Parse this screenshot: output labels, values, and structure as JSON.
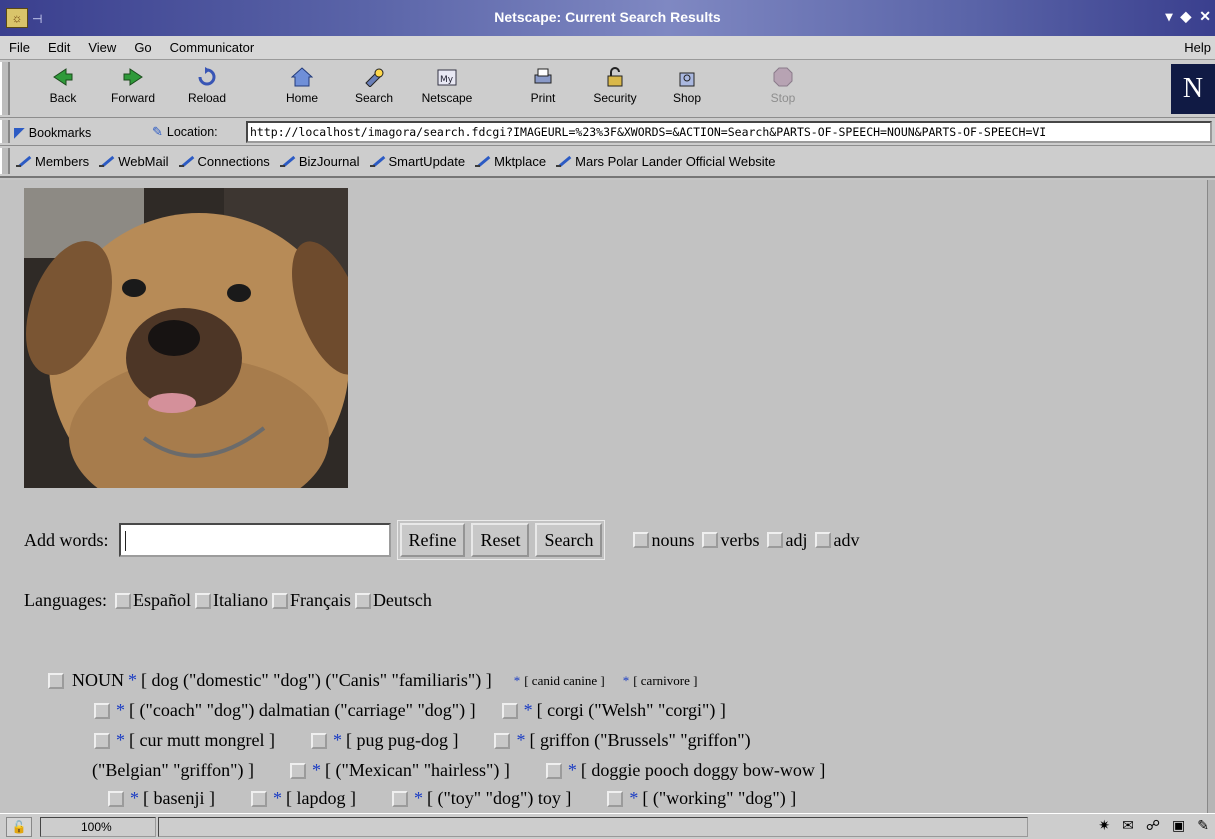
{
  "window": {
    "title": "Netscape: Current Search Results"
  },
  "menu": {
    "items": [
      "File",
      "Edit",
      "View",
      "Go",
      "Communicator"
    ],
    "help": "Help"
  },
  "toolbar": {
    "back": "Back",
    "forward": "Forward",
    "reload": "Reload",
    "home": "Home",
    "search": "Search",
    "netscape": "Netscape",
    "print": "Print",
    "security": "Security",
    "shop": "Shop",
    "stop": "Stop"
  },
  "location": {
    "bookmarks_label": "Bookmarks",
    "location_label": "Location:",
    "url": "http://localhost/imagora/search.fdcgi?IMAGEURL=%23%3F&XWORDS=&ACTION=Search&PARTS-OF-SPEECH=NOUN&PARTS-OF-SPEECH=VI"
  },
  "personal": {
    "links": [
      "Members",
      "WebMail",
      "Connections",
      "BizJournal",
      "SmartUpdate",
      "Mktplace",
      "Mars Polar Lander Official Website"
    ]
  },
  "search_form": {
    "add_words_label": "Add words:",
    "input_value": "",
    "refine": "Refine",
    "reset": "Reset",
    "search": "Search",
    "pos": [
      "nouns",
      "verbs",
      "adj",
      "adv"
    ],
    "languages_label": "Languages:",
    "languages": [
      "Español",
      "Italiano",
      "Français",
      "Deutsch"
    ]
  },
  "results": {
    "noun_label": "NOUN",
    "main": "[ dog (\"domestic\" \"dog\") (\"Canis\" \"familiaris\") ]",
    "hyper1": "[ canid canine ]",
    "hyper2": "[ carnivore ]",
    "r2a": "[ (\"coach\" \"dog\") dalmatian (\"carriage\" \"dog\") ]",
    "r2b": "[ corgi (\"Welsh\" \"corgi\") ]",
    "r3a": "[ cur mutt mongrel ]",
    "r3b": "[ pug pug-dog ]",
    "r3c": "[ griffon (\"Brussels\" \"griffon\")",
    "r4a": "(\"Belgian\" \"griffon\") ]",
    "r4b": "[ (\"Mexican\" \"hairless\") ]",
    "r4c": "[ doggie pooch doggy bow-wow ]",
    "r5a": "[ basenji ]",
    "r5b": "[ lapdog ]",
    "r5c": "[ (\"toy\" \"dog\") toy ]",
    "r5d": "[ (\"working\" \"dog\") ]",
    "star": "*"
  },
  "status": {
    "zoom": "100%"
  }
}
